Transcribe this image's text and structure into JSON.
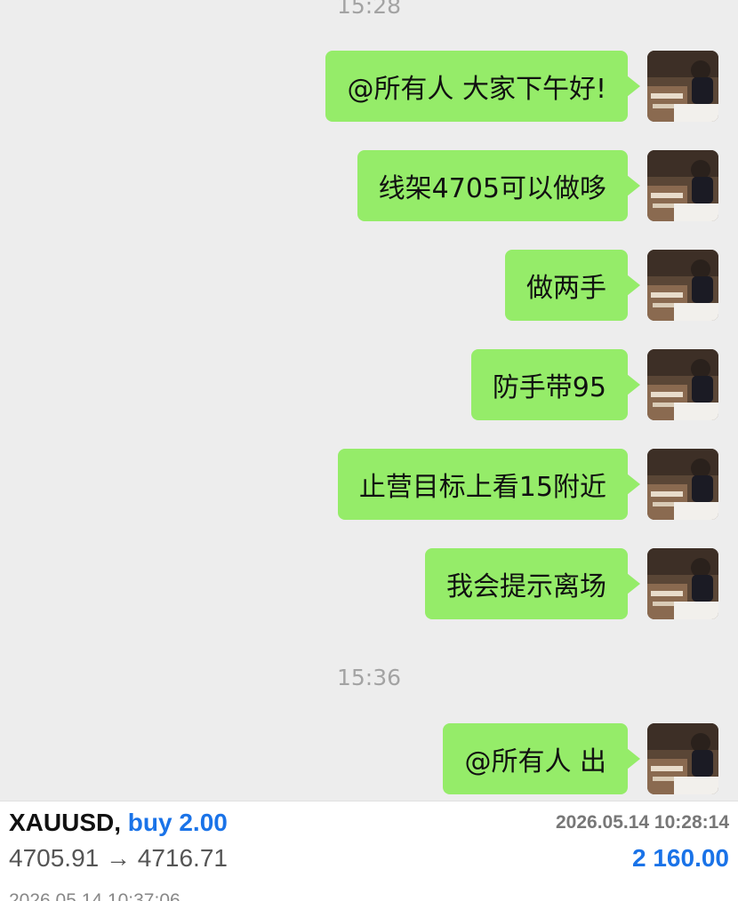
{
  "chat": {
    "time_top": "15:28",
    "messages": [
      {
        "text": "@所有人 大家下午好!"
      },
      {
        "text": "线架4705可以做哆"
      },
      {
        "text": "做两手"
      },
      {
        "text": "防手带95"
      },
      {
        "text": "止营目标上看15附近"
      },
      {
        "text": "我会提示离场"
      }
    ],
    "time_mid": "15:36",
    "last_message": {
      "text": "@所有人 出"
    },
    "bubble_color": "#95ec69"
  },
  "trade": {
    "symbol": "XAUUSD,",
    "side": "buy 2.00",
    "open_time": "2026.05.14 10:28:14",
    "prices": "4705.91 → 4716.71",
    "profit": "2 160.00",
    "close_time": "2026.05.14 10:37:06",
    "accent_color": "#1a73e8"
  }
}
